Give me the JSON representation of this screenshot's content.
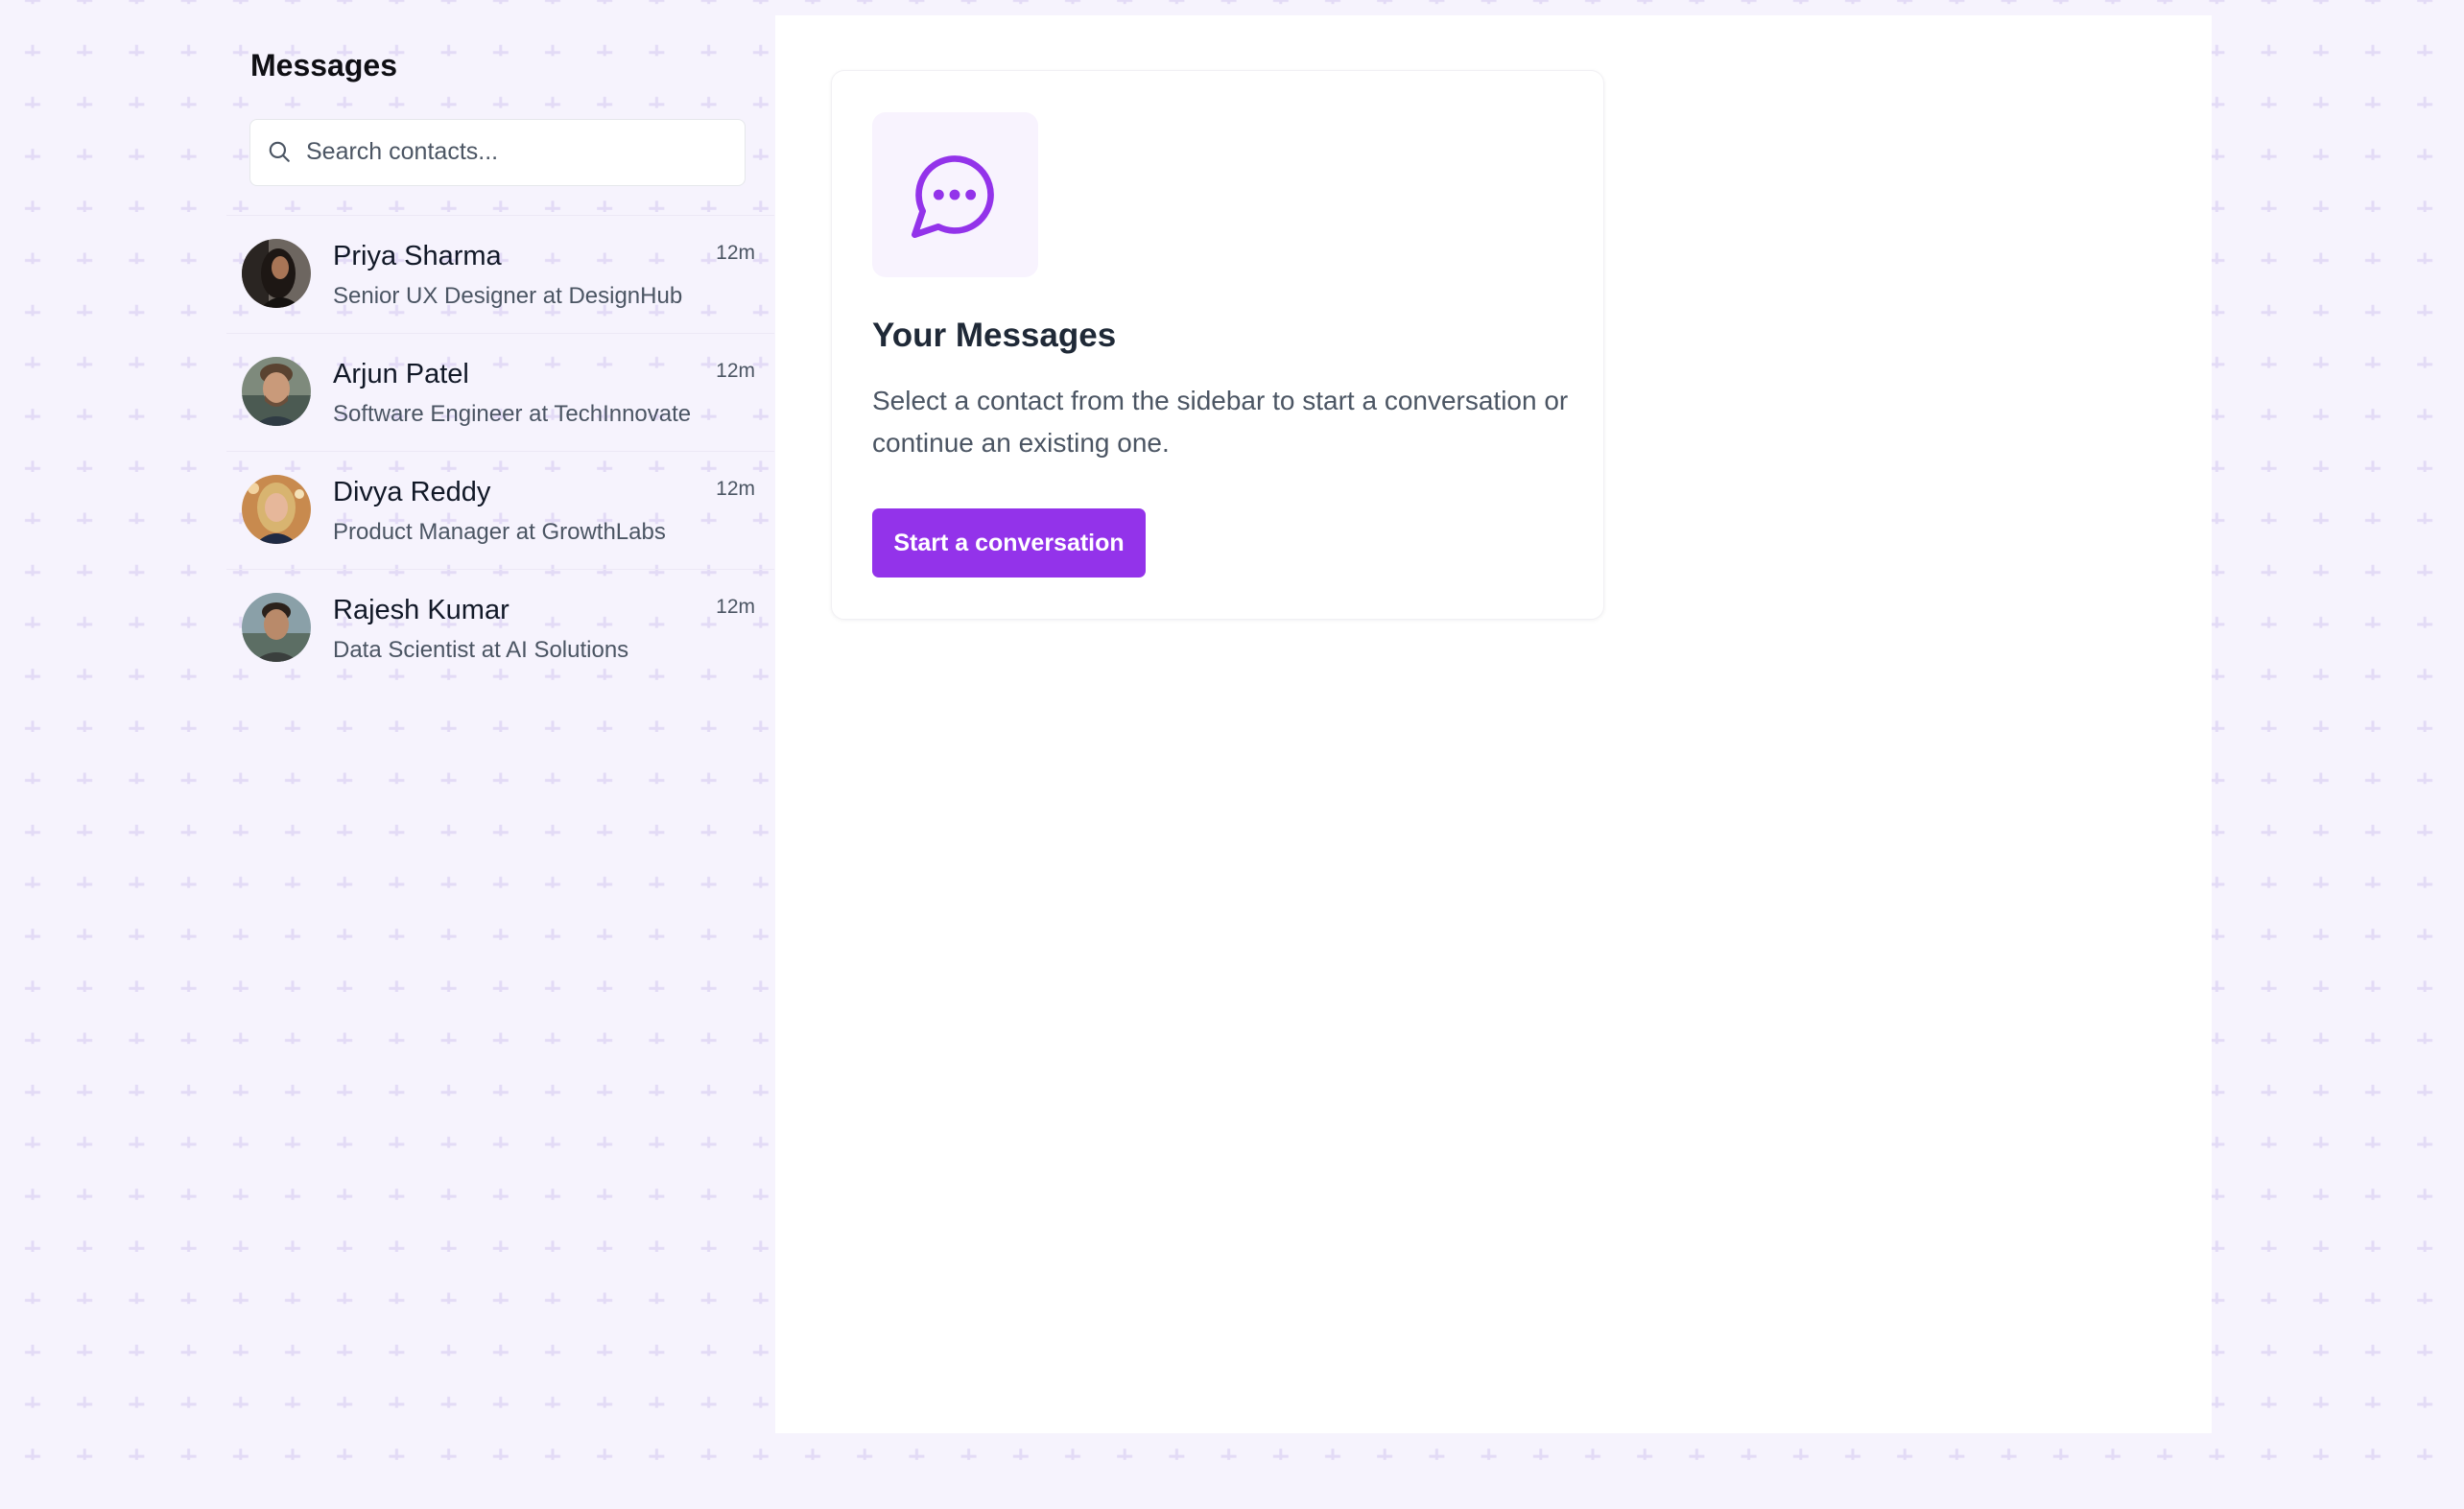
{
  "sidebar": {
    "title": "Messages",
    "search": {
      "placeholder": "Search contacts...",
      "value": ""
    },
    "contacts": [
      {
        "name": "Priya Sharma",
        "role": "Senior UX Designer at DesignHub",
        "time": "12m"
      },
      {
        "name": "Arjun Patel",
        "role": "Software Engineer at TechInnovate",
        "time": "12m"
      },
      {
        "name": "Divya Reddy",
        "role": "Product Manager at GrowthLabs",
        "time": "12m"
      },
      {
        "name": "Rajesh Kumar",
        "role": "Data Scientist at AI Solutions",
        "time": "12m"
      }
    ]
  },
  "main": {
    "empty_state": {
      "icon": "chat-bubble-icon",
      "title": "Your Messages",
      "description": "Select a contact from the sidebar to start a conversation or continue an existing one.",
      "button_label": "Start a conversation"
    }
  },
  "colors": {
    "accent": "#9333ea",
    "background": "#f6f3fd",
    "pattern": "#e3dbf6",
    "icon_tile": "#f8f3fe"
  }
}
